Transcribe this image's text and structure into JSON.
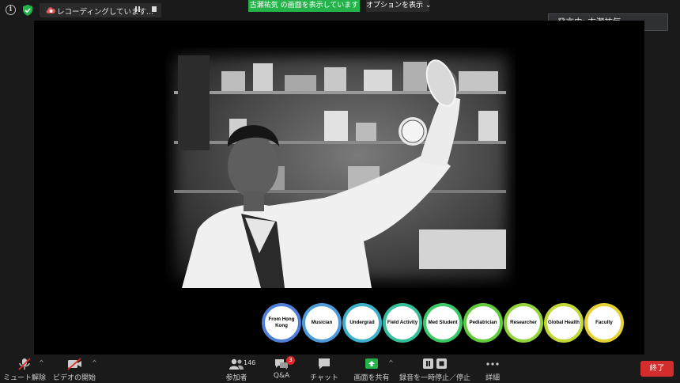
{
  "topbar": {
    "recording_text": "レコーディングしています...",
    "share_banner": "古瀬祐気 の画面を表示しています",
    "view_options": "オプションを表示",
    "icons": [
      "info-icon",
      "shield-check-icon",
      "cloud-record-icon",
      "pause-icon",
      "stop-icon",
      "chevron-down-icon"
    ]
  },
  "speaker": {
    "label": "発言中: 古瀬祐気"
  },
  "timeline": {
    "items": [
      {
        "label": "From Hong Kong",
        "color": "#4f7fd6"
      },
      {
        "label": "Musician",
        "color": "#4e9bd9"
      },
      {
        "label": "Undergrad",
        "color": "#3fb0c9"
      },
      {
        "label": "Field Activity",
        "color": "#34bf9a"
      },
      {
        "label": "Med Student",
        "color": "#3cc869"
      },
      {
        "label": "Pediatrician",
        "color": "#60cc3c"
      },
      {
        "label": "Researcher",
        "color": "#92d23a"
      },
      {
        "label": "Global Health",
        "color": "#c2d736"
      },
      {
        "label": "Faculty",
        "color": "#e6d133"
      }
    ]
  },
  "toolbar": {
    "mute": "ミュート解除",
    "video": "ビデオの開始",
    "participants": "参加者",
    "participants_count": "146",
    "qa": "Q&A",
    "qa_badge": "3",
    "chat": "チャット",
    "share": "画面を共有",
    "recording": "録音を一時停止／停止",
    "more": "詳細",
    "end": "終了"
  },
  "colors": {
    "share_green": "#24b34a",
    "end_red": "#d32c2c",
    "toolbar_bg": "#1a1a1a"
  }
}
